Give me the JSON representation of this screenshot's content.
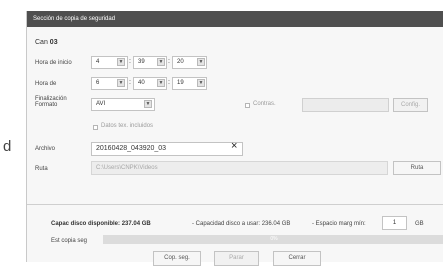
{
  "background": {
    "edge_letter": "d"
  },
  "dialog": {
    "title": "Sección de copia de seguridad",
    "channel_label": "Can",
    "channel_value": "03",
    "start": {
      "label": "Hora de inicio",
      "hh": "4",
      "mm": "39",
      "ss": "20"
    },
    "end": {
      "label": "Hora de",
      "hh": "6",
      "mm": "40",
      "ss": "19"
    },
    "format": {
      "label_line1": "Finalización",
      "label_line2": "Formato",
      "value": "AVI"
    },
    "password": {
      "label": "Contras.",
      "value": "",
      "config_button": "Config."
    },
    "text_data_label": "Datos tex. incluidos",
    "file": {
      "label": "Archivo",
      "value": "20160428_043920_03",
      "clear_icon": "×"
    },
    "path": {
      "label": "Ruta",
      "value": "C:\\Users\\CNPK\\Videos",
      "button": "Ruta"
    },
    "disk": {
      "available_label": "Capac disco disponible:",
      "available_value": "237.04 GB",
      "to_use_text": "- Capacidad disco a usar: 236.04 GB",
      "margin_label": "- Espacio marg mín:",
      "margin_value": "1",
      "margin_unit": "GB"
    },
    "progress": {
      "label": "Est copia seg",
      "percent_text": "0%",
      "percent": 0
    },
    "buttons": {
      "backup": "Cop. seg.",
      "stop": "Parar",
      "close": "Cerrar"
    }
  },
  "colors": {
    "titlebar": "#4f4f4f",
    "progress_fill": "#dcdcdc"
  }
}
